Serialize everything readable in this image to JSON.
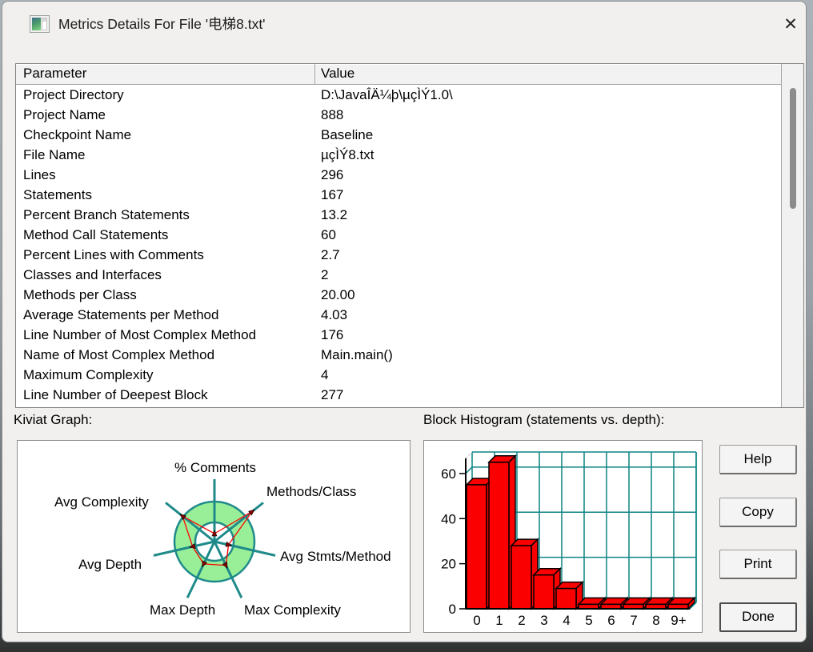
{
  "window": {
    "title": "Metrics Details For File '电梯8.txt'",
    "close_icon": "✕"
  },
  "table": {
    "columns": [
      "Parameter",
      "Value"
    ],
    "rows": [
      {
        "param": "Project Directory",
        "value": "D:\\JavaÎÄ¼þ\\µçÌÝ1.0\\"
      },
      {
        "param": "Project Name",
        "value": "888"
      },
      {
        "param": "Checkpoint Name",
        "value": "Baseline"
      },
      {
        "param": "File Name",
        "value": "µçÌÝ8.txt"
      },
      {
        "param": "Lines",
        "value": "296"
      },
      {
        "param": "Statements",
        "value": "167"
      },
      {
        "param": "Percent Branch Statements",
        "value": "13.2"
      },
      {
        "param": "Method Call Statements",
        "value": "60"
      },
      {
        "param": "Percent Lines with Comments",
        "value": "2.7"
      },
      {
        "param": "Classes and Interfaces",
        "value": "2"
      },
      {
        "param": "Methods per Class",
        "value": "20.00"
      },
      {
        "param": "Average Statements per Method",
        "value": "4.03"
      },
      {
        "param": "Line Number of Most Complex Method",
        "value": "176"
      },
      {
        "param": "Name of Most Complex Method",
        "value": "Main.main()"
      },
      {
        "param": "Maximum Complexity",
        "value": "4"
      },
      {
        "param": "Line Number of Deepest Block",
        "value": "277"
      }
    ]
  },
  "kiviat": {
    "label": "Kiviat Graph:"
  },
  "histogram": {
    "label": "Block Histogram (statements vs. depth):"
  },
  "buttons": [
    {
      "label": "Help",
      "default": false
    },
    {
      "label": "Copy",
      "default": false
    },
    {
      "label": "Print",
      "default": false
    },
    {
      "label": "Done",
      "default": true
    }
  ],
  "chart_data": [
    {
      "type": "radar",
      "title": "Kiviat Graph",
      "axes": [
        "% Comments",
        "Methods/Class",
        "Avg Stmts/Method",
        "Max Complexity",
        "Max Depth",
        "Avg Depth",
        "Avg Complexity"
      ],
      "radius_fractions": [
        0.2,
        1.2,
        0.36,
        0.66,
        0.62,
        0.56,
        1.02
      ],
      "ring_inner_fraction": 0.48,
      "ring_outer_fraction": 1.0,
      "colors": {
        "spoke": "#1f8a8a",
        "ring_fill": "#98ef98",
        "polygon": "#ff0000",
        "marker": "#8a0000"
      }
    },
    {
      "type": "bar",
      "title": "Block Histogram (statements vs. depth)",
      "xlabel": "depth",
      "ylabel": "statements",
      "categories": [
        "0",
        "1",
        "2",
        "3",
        "4",
        "5",
        "6",
        "7",
        "8",
        "9+"
      ],
      "values": [
        55,
        65,
        28,
        15,
        9,
        2,
        2,
        2,
        2,
        2
      ],
      "yticks": [
        0,
        20,
        40,
        60
      ],
      "ylim": [
        0,
        66.7
      ],
      "grid": true,
      "colors": {
        "bar": "#fb0000",
        "grid": "#0d8484",
        "axis": "#000000"
      }
    }
  ]
}
